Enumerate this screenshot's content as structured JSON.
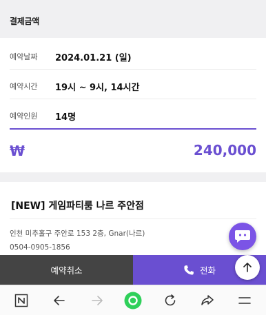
{
  "payment_section": {
    "title": "결제금액"
  },
  "reservation": {
    "date_label": "예약날짜",
    "date_value": "2024.01.21 (일)",
    "time_label": "예약시간",
    "time_value": "19시 ~ 9시,  14시간",
    "people_label": "예약인원",
    "people_value": "14명"
  },
  "total": {
    "currency": "₩",
    "amount": "240,000"
  },
  "venue": {
    "name": "[NEW] 게임파티룸 나르 주안점",
    "address": "인천 미추홀구 주안로 153 2층, Gnar(나르)",
    "phone": "0504-0905-1856"
  },
  "actions": {
    "cancel_label": "예약취소",
    "call_label": "전화"
  },
  "browser": {
    "icons": [
      "naver-n-icon",
      "back-arrow-icon",
      "forward-arrow-icon",
      "home-icon",
      "refresh-icon",
      "share-icon",
      "menu-icon"
    ]
  },
  "colors": {
    "accent": "#6a4fd1",
    "cancel_bg": "#444444",
    "chat_fab": "#7b54e6",
    "home_green": "#2fd05a"
  }
}
